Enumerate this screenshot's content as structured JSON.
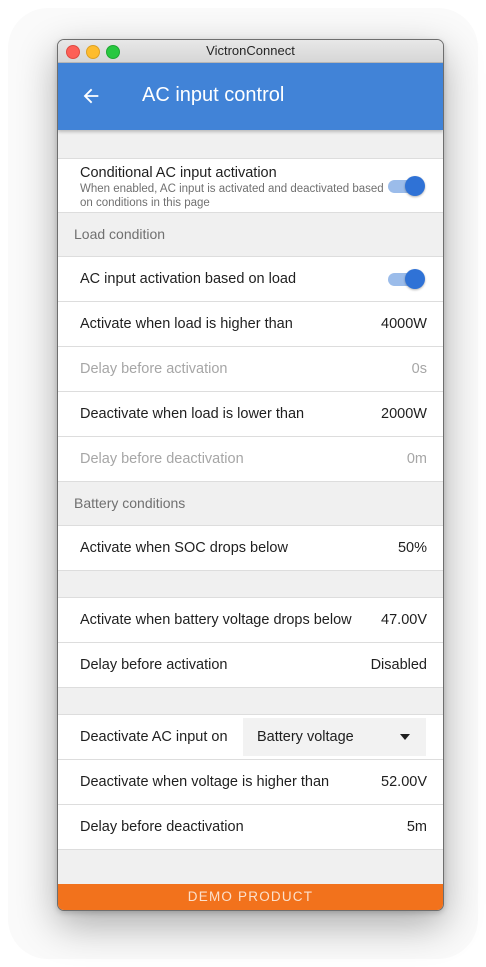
{
  "window": {
    "title": "VictronConnect"
  },
  "appbar": {
    "title": "AC input control"
  },
  "conditional": {
    "title": "Conditional AC input activation",
    "description": "When enabled, AC input is activated and deactivated based on conditions in this page",
    "enabled": true
  },
  "load": {
    "header": "Load condition",
    "activation_label": "AC input activation based on load",
    "activation_enabled": true,
    "activate_higher_label": "Activate when load is higher than",
    "activate_higher_value": "4000W",
    "delay_activation_label": "Delay before activation",
    "delay_activation_value": "0s",
    "deactivate_lower_label": "Deactivate when load is lower than",
    "deactivate_lower_value": "2000W",
    "delay_deactivation_label": "Delay before deactivation",
    "delay_deactivation_value": "0m"
  },
  "battery": {
    "header": "Battery conditions",
    "soc_label": "Activate when SOC drops below",
    "soc_value": "50%",
    "voltage_label": "Activate when battery voltage drops below",
    "voltage_value": "47.00V",
    "delay_activation_label": "Delay before activation",
    "delay_activation_value": "Disabled",
    "deactivate_on_label": "Deactivate AC input on",
    "deactivate_on_selected": "Battery voltage",
    "deactivate_higher_label": "Deactivate when voltage is higher than",
    "deactivate_higher_value": "52.00V",
    "delay_deactivation_label": "Delay before deactivation",
    "delay_deactivation_value": "5m"
  },
  "footer": {
    "demo_label": "DEMO PRODUCT"
  },
  "colors": {
    "appbar": "#4183d7",
    "toggle_on": "#2f72d6",
    "demo_bar": "#f2721c"
  },
  "icons": [
    "back-arrow-icon",
    "dropdown-caret-icon"
  ]
}
